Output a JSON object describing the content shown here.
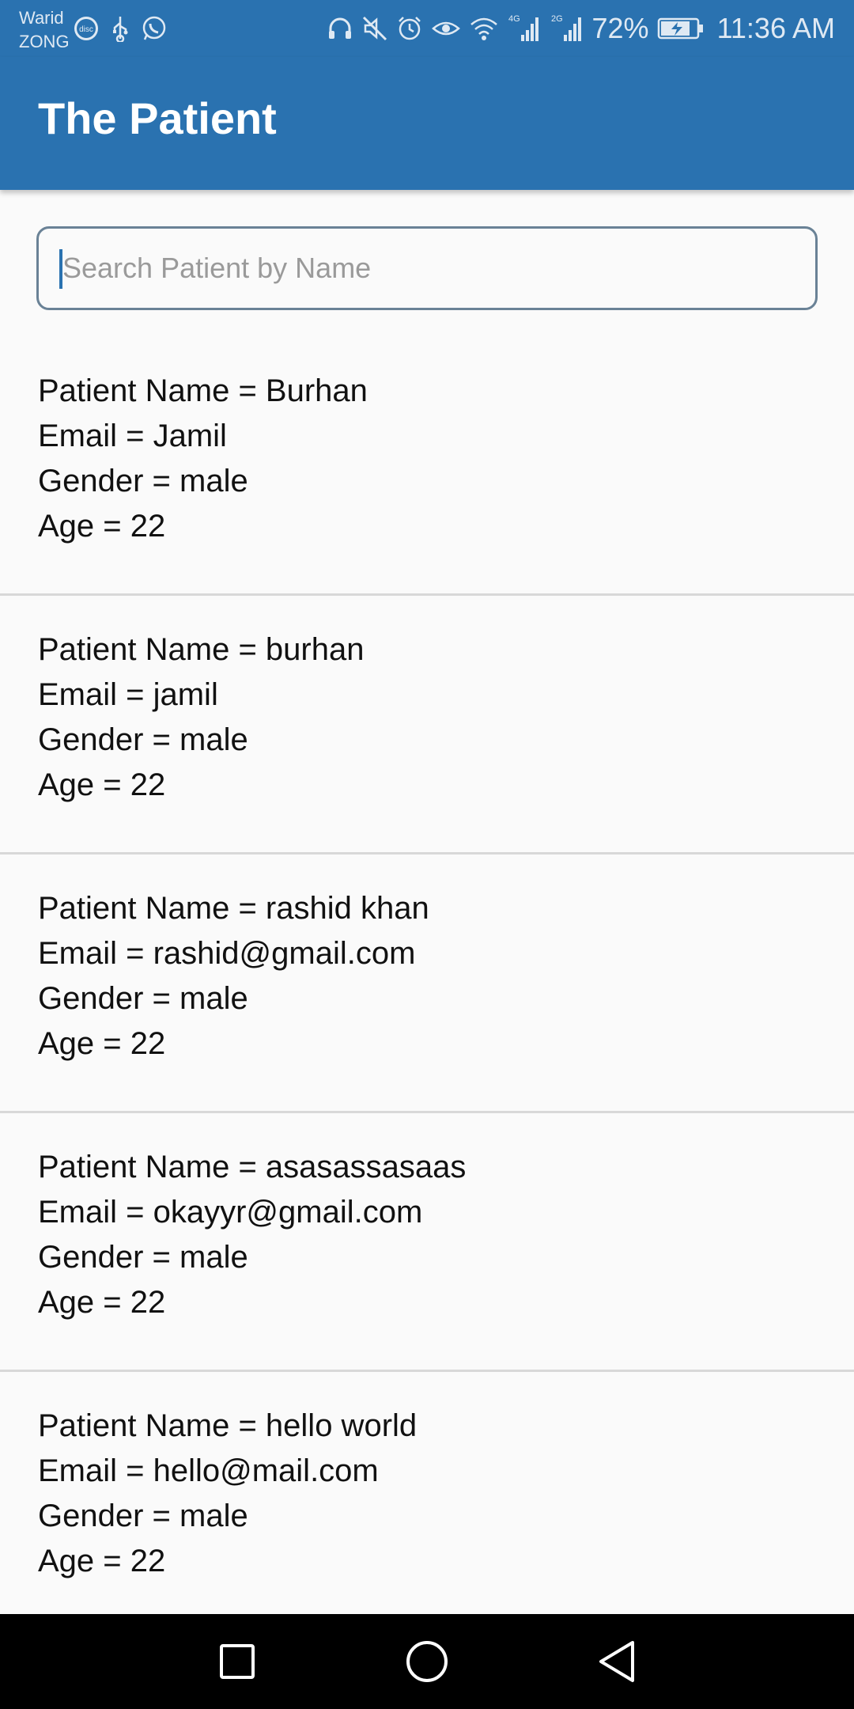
{
  "status_bar": {
    "carrier_line1": "Warid",
    "carrier_line2": "ZONG",
    "network1": "4G",
    "network2": "2G",
    "battery_pct": "72%",
    "time": "11:36 AM",
    "icons": [
      "disc-icon",
      "usb-icon",
      "whatsapp-icon",
      "headset-icon",
      "mute-icon",
      "alarm-icon",
      "eye-icon",
      "wifi-icon",
      "signal-icon",
      "battery-charging-icon"
    ]
  },
  "app_bar": {
    "title": "The Patient"
  },
  "search": {
    "placeholder": "Search Patient by Name",
    "value": ""
  },
  "patients": [
    {
      "name_line": "Patient Name = Burhan",
      "email_line": "Email = Jamil",
      "gender_line": "Gender = male",
      "age_line": "Age = 22"
    },
    {
      "name_line": "Patient Name = burhan",
      "email_line": "Email = jamil",
      "gender_line": "Gender = male",
      "age_line": "Age = 22"
    },
    {
      "name_line": "Patient Name = rashid khan",
      "email_line": "Email = rashid@gmail.com",
      "gender_line": "Gender = male",
      "age_line": "Age = 22"
    },
    {
      "name_line": "Patient Name = asasassasaas",
      "email_line": "Email = okayyr@gmail.com",
      "gender_line": "Gender = male",
      "age_line": "Age = 22"
    },
    {
      "name_line": "Patient Name = hello world",
      "email_line": "Email = hello@mail.com",
      "gender_line": "Gender = male",
      "age_line": "Age = 22"
    }
  ],
  "nav_bar": {
    "icons": [
      "recents-square-icon",
      "home-circle-icon",
      "back-triangle-icon"
    ]
  },
  "colors": {
    "primary": "#2a72b0",
    "background": "#fafafa",
    "divider": "#d8d8d8",
    "search_border": "#6a8296"
  }
}
